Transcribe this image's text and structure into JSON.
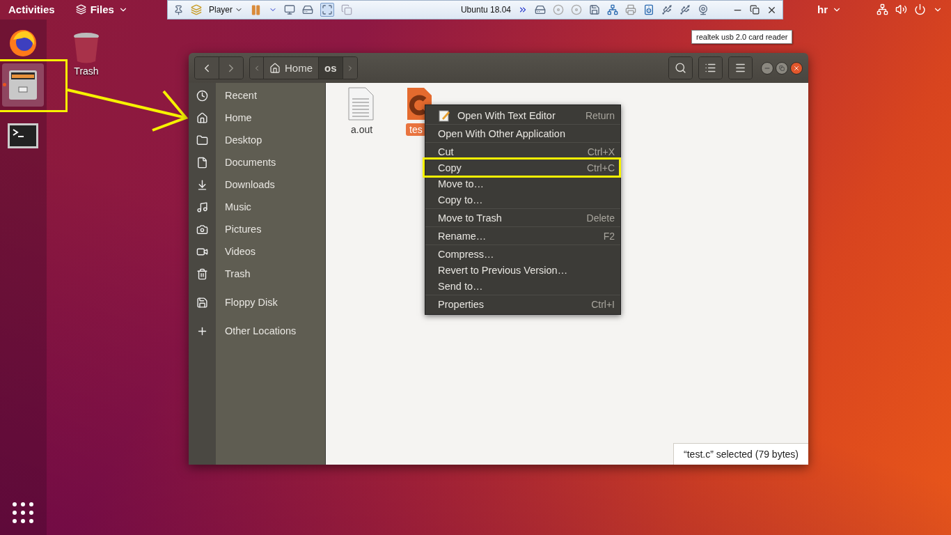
{
  "top_bar": {
    "activities": "Activities",
    "app_menu": "Files",
    "keyboard": "hr"
  },
  "vm_toolbar": {
    "player": "Player",
    "vm_name": "Ubuntu 18.04",
    "tooltip": "realtek usb 2.0 card reader"
  },
  "dock": [
    {
      "kind": "firefox",
      "selected": false,
      "running": false,
      "annotated": false
    },
    {
      "kind": "files",
      "selected": true,
      "running": true,
      "annotated": true
    },
    {
      "kind": "terminal",
      "selected": false,
      "running": false,
      "annotated": false
    }
  ],
  "desktop_icons": [
    {
      "label": "Trash"
    }
  ],
  "window": {
    "path": [
      {
        "label": "Home",
        "kind": "home",
        "selected": false
      },
      {
        "label": "os",
        "kind": "folder",
        "selected": true
      }
    ],
    "sidebar": [
      [
        {
          "label": "Recent",
          "kind": "recent"
        },
        {
          "label": "Home",
          "kind": "home"
        },
        {
          "label": "Desktop",
          "kind": "desktop"
        },
        {
          "label": "Documents",
          "kind": "documents"
        },
        {
          "label": "Downloads",
          "kind": "downloads"
        },
        {
          "label": "Music",
          "kind": "music"
        },
        {
          "label": "Pictures",
          "kind": "pictures"
        },
        {
          "label": "Videos",
          "kind": "videos"
        },
        {
          "label": "Trash",
          "kind": "trash"
        }
      ],
      [
        {
          "label": "Floppy Disk",
          "kind": "floppy"
        }
      ],
      [
        {
          "label": "Other Locations",
          "kind": "other"
        }
      ]
    ],
    "files": [
      {
        "name": "a.out",
        "kind": "binary",
        "selected": false
      },
      {
        "name": "tes",
        "kind": "c-source",
        "selected": true
      }
    ],
    "status": "“test.c” selected  (79 bytes)"
  },
  "context_menu": [
    [
      {
        "label": "Open With Text Editor",
        "shortcut": "Return",
        "icon": true,
        "annotated": false
      }
    ],
    [
      {
        "label": "Open With Other Application",
        "icon": false,
        "annotated": false
      }
    ],
    [
      {
        "label": "Cut",
        "shortcut": "Ctrl+X",
        "icon": false,
        "annotated": false
      },
      {
        "label": "Copy",
        "shortcut": "Ctrl+C",
        "icon": false,
        "annotated": true
      },
      {
        "label": "Move to…",
        "icon": false,
        "annotated": false
      },
      {
        "label": "Copy to…",
        "icon": false,
        "annotated": false
      }
    ],
    [
      {
        "label": "Move to Trash",
        "shortcut": "Delete",
        "icon": false,
        "annotated": false
      }
    ],
    [
      {
        "label": "Rename…",
        "shortcut": "F2",
        "icon": false,
        "annotated": false
      }
    ],
    [
      {
        "label": "Compress…",
        "icon": false,
        "annotated": false
      },
      {
        "label": "Revert to Previous Version…",
        "icon": false,
        "annotated": false
      },
      {
        "label": "Send to…",
        "icon": false,
        "annotated": false
      }
    ],
    [
      {
        "label": "Properties",
        "shortcut": "Ctrl+I",
        "icon": false,
        "annotated": false
      }
    ]
  ]
}
